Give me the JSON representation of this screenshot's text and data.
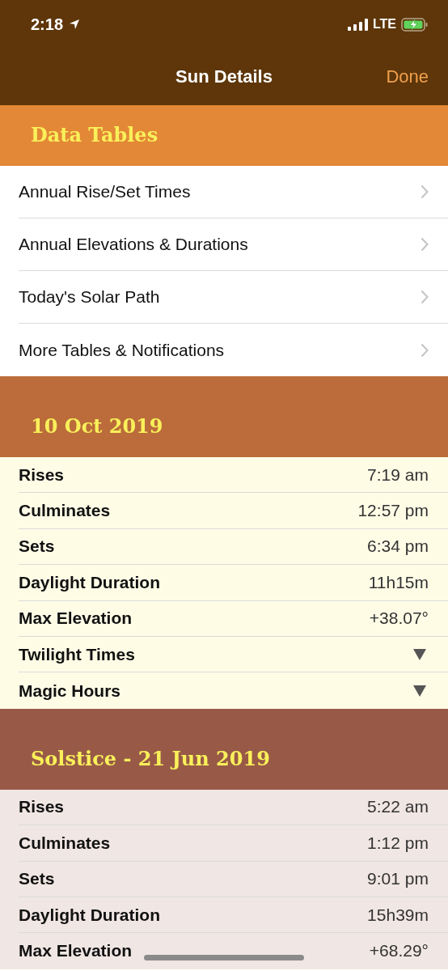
{
  "status_bar": {
    "time": "2:18",
    "network": "LTE"
  },
  "nav_bar": {
    "title": "Sun Details",
    "done": "Done"
  },
  "sections": [
    {
      "kind": "links",
      "title": "Data Tables",
      "color": "#e38836",
      "rows": [
        {
          "label": "Annual Rise/Set Times"
        },
        {
          "label": "Annual Elevations & Durations"
        },
        {
          "label": "Today's Solar Path"
        },
        {
          "label": "More Tables & Notifications"
        }
      ]
    },
    {
      "kind": "values",
      "title": "10 Oct 2019",
      "color": "#bb6c3a",
      "rows": [
        {
          "kind": "value",
          "label": "Rises",
          "value": "7:19 am"
        },
        {
          "kind": "value",
          "label": "Culminates",
          "value": "12:57 pm"
        },
        {
          "kind": "value",
          "label": "Sets",
          "value": "6:34 pm"
        },
        {
          "kind": "value",
          "label": "Daylight Duration",
          "value": "11h15m"
        },
        {
          "kind": "value",
          "label": "Max Elevation",
          "value": "+38.07°"
        },
        {
          "kind": "expander",
          "label": "Twilight Times",
          "expanded": false
        },
        {
          "kind": "expander",
          "label": "Magic Hours",
          "expanded": false
        }
      ]
    },
    {
      "kind": "values",
      "title": "Solstice - 21 Jun 2019",
      "color": "#985a47",
      "rows": [
        {
          "kind": "value",
          "label": "Rises",
          "value": "5:22 am"
        },
        {
          "kind": "value",
          "label": "Culminates",
          "value": "1:12 pm"
        },
        {
          "kind": "value",
          "label": "Sets",
          "value": "9:01 pm"
        },
        {
          "kind": "value",
          "label": "Daylight Duration",
          "value": "15h39m"
        },
        {
          "kind": "value",
          "label": "Max Elevation",
          "value": "+68.29°"
        }
      ]
    }
  ]
}
